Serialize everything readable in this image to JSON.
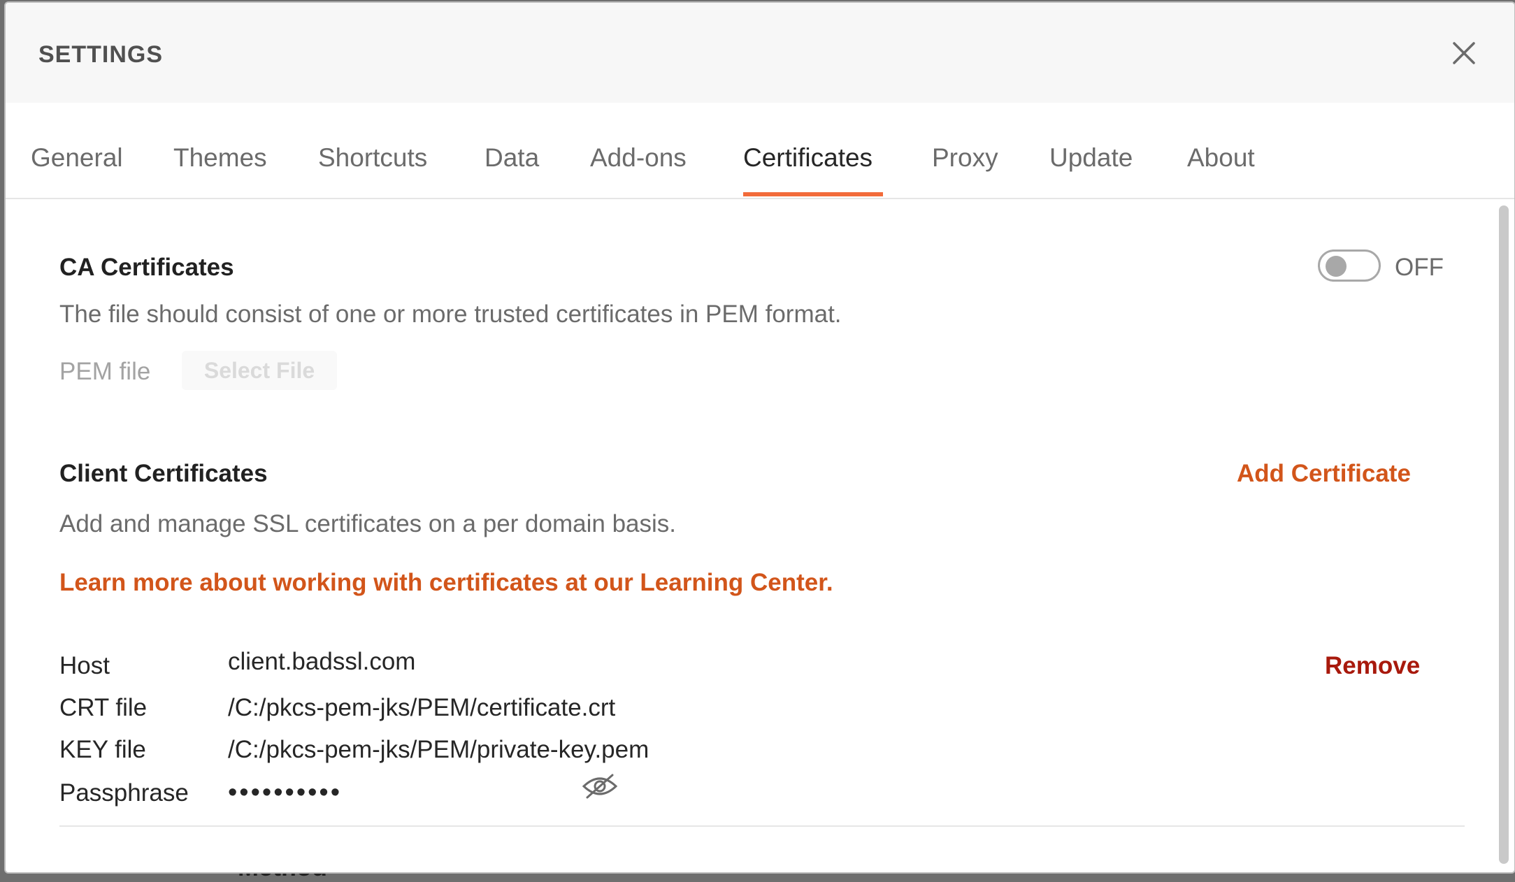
{
  "background": {
    "partial_text": "Method"
  },
  "dialog": {
    "title": "SETTINGS",
    "close_icon": "close-icon",
    "tabs": [
      {
        "label": "General"
      },
      {
        "label": "Themes"
      },
      {
        "label": "Shortcuts"
      },
      {
        "label": "Data"
      },
      {
        "label": "Add-ons"
      },
      {
        "label": "Certificates"
      },
      {
        "label": "Proxy"
      },
      {
        "label": "Update"
      },
      {
        "label": "About"
      }
    ],
    "active_tab": "Certificates"
  },
  "ca_certificates": {
    "title": "CA Certificates",
    "toggle_state": "OFF",
    "description": "The file should consist of one or more trusted certificates in PEM format.",
    "pem_label": "PEM file",
    "select_file_label": "Select File"
  },
  "client_certificates": {
    "title": "Client Certificates",
    "add_label": "Add Certificate",
    "description": "Add and manage SSL certificates on a per domain basis.",
    "learn_more": "Learn more about working with certificates at our Learning Center.",
    "entry": {
      "host_label": "Host",
      "host_value": "client.badssl.com",
      "crt_label": "CRT file",
      "crt_value": "/C:/pkcs-pem-jks/PEM/certificate.crt",
      "key_label": "KEY file",
      "key_value": "/C:/pkcs-pem-jks/PEM/private-key.pem",
      "passphrase_label": "Passphrase",
      "passphrase_value": "••••••••••",
      "remove_label": "Remove",
      "visibility_icon": "eye-off-icon"
    }
  },
  "colors": {
    "accent": "#f26b3a",
    "link": "#d2551a",
    "danger": "#a8190c"
  }
}
